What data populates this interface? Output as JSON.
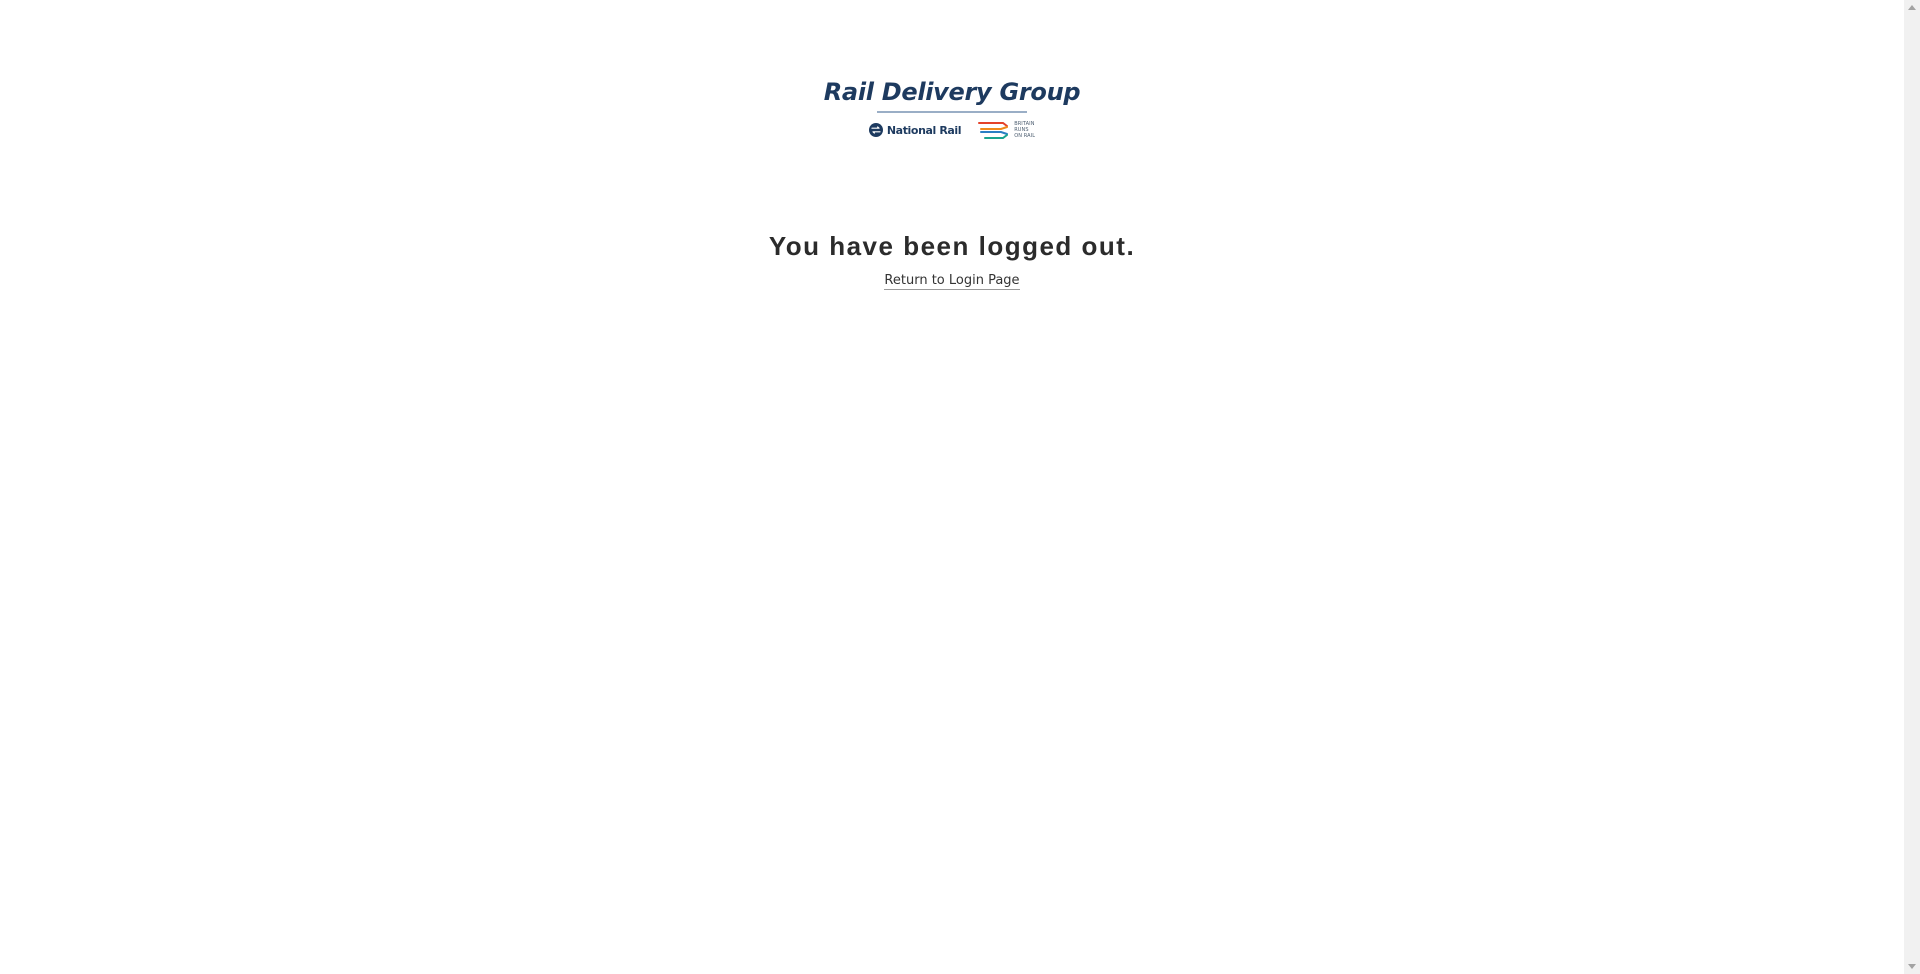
{
  "logo": {
    "title": "Rail Delivery Group",
    "national_rail_label": "National Rail",
    "brr_lines": [
      "BRITAIN",
      "RUNS",
      "ON RAIL"
    ],
    "brand_color": "#1d3a5f"
  },
  "logout": {
    "message": "You have been logged out.",
    "login_link_label": "Return to Login Page"
  },
  "icons": {
    "national_rail": "national-rail-double-arrow-icon",
    "britain_runs_on_rail": "britain-runs-on-rail-arrows-icon",
    "scroll_up": "chevron-up-icon",
    "scroll_down": "chevron-down-icon"
  }
}
